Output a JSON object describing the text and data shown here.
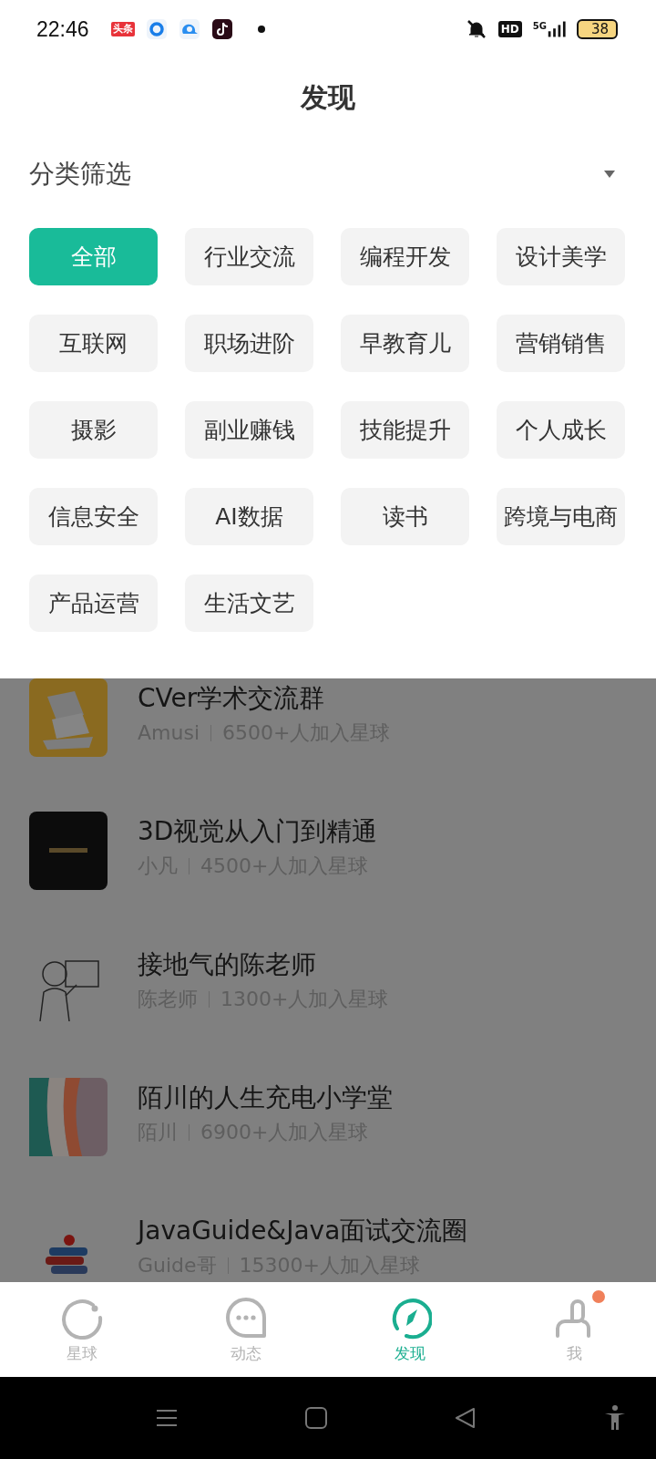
{
  "status_bar": {
    "time": "22:46",
    "app_badge": "头条",
    "network_badge": "HD",
    "network_type": "5G",
    "battery": "38"
  },
  "header": {
    "title": "发现"
  },
  "filter": {
    "label": "分类筛选",
    "expanded": true,
    "chips": [
      {
        "label": "全部",
        "selected": true
      },
      {
        "label": "行业交流",
        "selected": false
      },
      {
        "label": "编程开发",
        "selected": false
      },
      {
        "label": "设计美学",
        "selected": false
      },
      {
        "label": "互联网",
        "selected": false
      },
      {
        "label": "职场进阶",
        "selected": false
      },
      {
        "label": "早教育儿",
        "selected": false
      },
      {
        "label": "营销销售",
        "selected": false
      },
      {
        "label": "摄影",
        "selected": false
      },
      {
        "label": "副业赚钱",
        "selected": false
      },
      {
        "label": "技能提升",
        "selected": false
      },
      {
        "label": "个人成长",
        "selected": false
      },
      {
        "label": "信息安全",
        "selected": false
      },
      {
        "label": "AI数据",
        "selected": false
      },
      {
        "label": "读书",
        "selected": false
      },
      {
        "label": "跨境与电商",
        "selected": false
      },
      {
        "label": "产品运营",
        "selected": false
      },
      {
        "label": "生活文艺",
        "selected": false
      }
    ]
  },
  "groups": [
    {
      "title": "CVer学术交流群",
      "owner": "Amusi",
      "members": "6500+人加入星球"
    },
    {
      "title": "3D视觉从入门到精通",
      "owner": "小凡",
      "members": "4500+人加入星球"
    },
    {
      "title": "接地气的陈老师",
      "owner": "陈老师",
      "members": "1300+人加入星球"
    },
    {
      "title": "陌川的人生充电小学堂",
      "owner": "陌川",
      "members": "6900+人加入星球"
    },
    {
      "title": "JavaGuide&Java面试交流圈",
      "owner": "Guide哥",
      "members": "15300+人加入星球"
    }
  ],
  "tab_bar": [
    {
      "label": "星球",
      "selected": false,
      "badge": false
    },
    {
      "label": "动态",
      "selected": false,
      "badge": false
    },
    {
      "label": "发现",
      "selected": true,
      "badge": false
    },
    {
      "label": "我",
      "selected": false,
      "badge": true
    }
  ]
}
